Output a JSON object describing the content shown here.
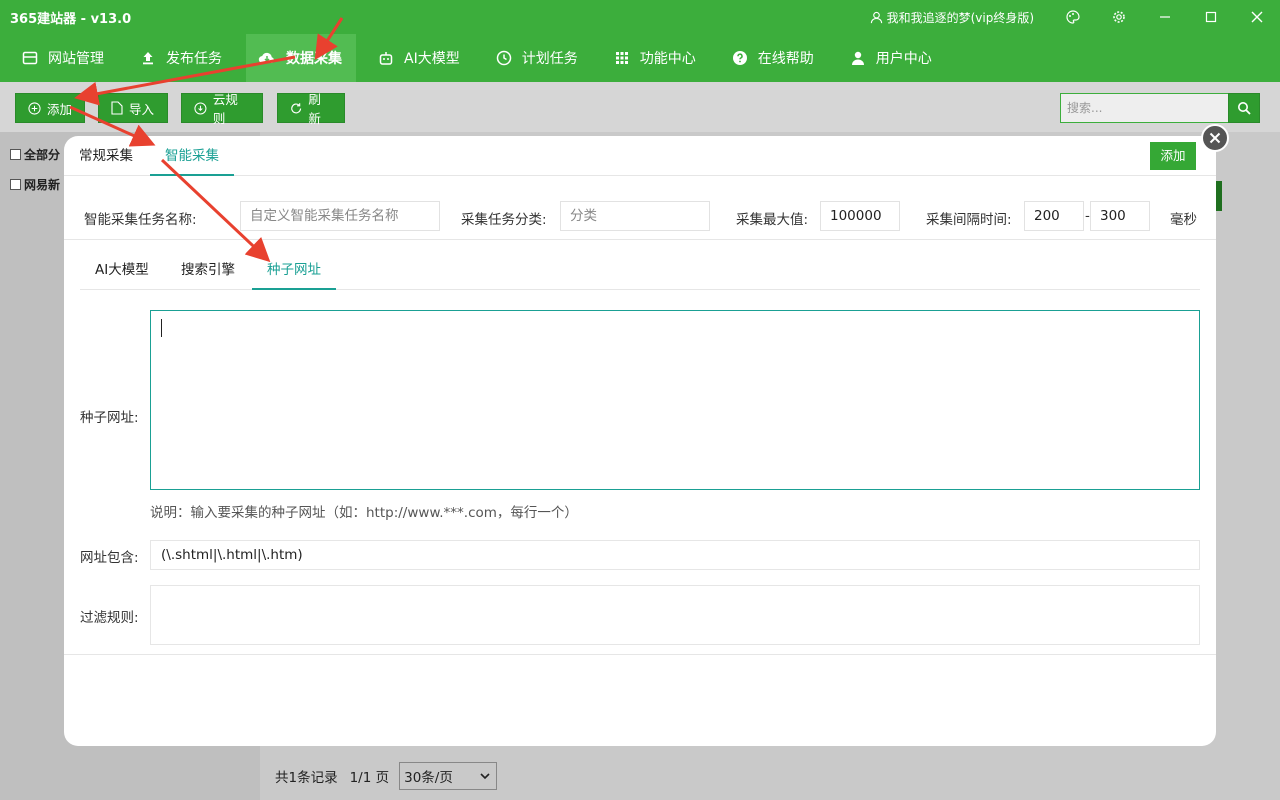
{
  "window": {
    "title": "365建站器 - v13.0",
    "user": "我和我追逐的梦(vip终身版)"
  },
  "nav": {
    "items": [
      {
        "label": "网站管理",
        "icon": "website-icon"
      },
      {
        "label": "发布任务",
        "icon": "upload-icon"
      },
      {
        "label": "数据采集",
        "icon": "cloud-download-icon"
      },
      {
        "label": "AI大模型",
        "icon": "robot-icon"
      },
      {
        "label": "计划任务",
        "icon": "clock-icon"
      },
      {
        "label": "功能中心",
        "icon": "grid-icon"
      },
      {
        "label": "在线帮助",
        "icon": "help-icon"
      },
      {
        "label": "用户中心",
        "icon": "user-icon"
      }
    ],
    "active_index": 2
  },
  "toolbar": {
    "add": "添加",
    "import": "导入",
    "cloud_rules": "云规则",
    "refresh": "刷新",
    "search_placeholder": "搜索..."
  },
  "left_pane": {
    "items": [
      "全部分",
      "网易新"
    ]
  },
  "pager": {
    "summary": "共1条记录",
    "pages": "1/1 页",
    "per_page": "30条/页"
  },
  "modal": {
    "tabs": [
      "常规采集",
      "智能采集"
    ],
    "active_tab": 1,
    "add_button": "添加",
    "params": {
      "task_name_label": "智能采集任务名称:",
      "task_name_placeholder": "自定义智能采集任务名称",
      "category_label": "采集任务分类:",
      "category_placeholder": "分类",
      "max_label": "采集最大值:",
      "max_value": "100000",
      "interval_label": "采集间隔时间:",
      "interval_min": "200",
      "interval_sep": "-",
      "interval_max": "300",
      "interval_unit": "毫秒"
    },
    "subtabs": [
      "AI大模型",
      "搜索引擎",
      "种子网址"
    ],
    "active_subtab": 2,
    "seed_label": "种子网址:",
    "seed_value": "",
    "seed_hint": "说明：输入要采集的种子网址（如：http://www.***.com，每行一个）",
    "include_label": "网址包含:",
    "include_value": "(\\.shtml|\\.html|\\.htm)",
    "filter_label": "过滤规则:",
    "filter_value": ""
  },
  "colors": {
    "brand_green": "#3cae3c",
    "tab_accent": "#1aa094",
    "annotation_red": "#e8412f"
  }
}
